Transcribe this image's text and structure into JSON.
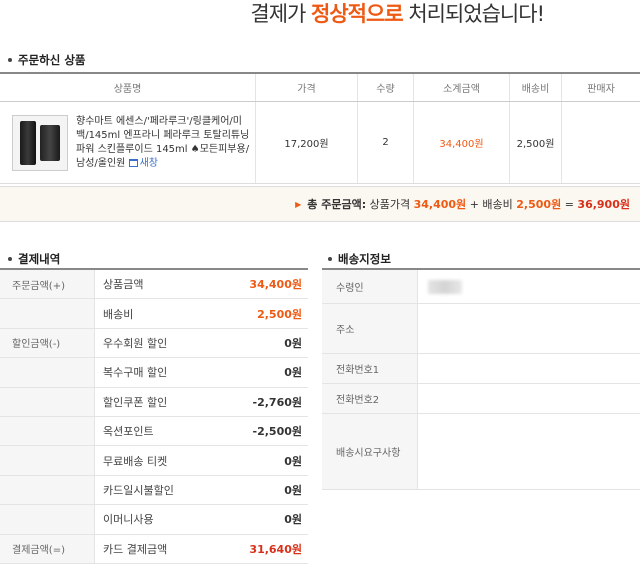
{
  "banner": {
    "before": "결제가 ",
    "highlight": "정상적으로",
    "after": " 처리되었습니다!"
  },
  "order_section": {
    "title": "주문하신 상품"
  },
  "order_table": {
    "headers": [
      "상품명",
      "가격",
      "수량",
      "소계금액",
      "배송비",
      "판매자"
    ],
    "row": {
      "product_name": "향수마트 에센스/'페라루크'/링클케어/미백/145ml 엔프라니 페라루크 토탈리튜닝 파워 스킨플루이드 145ml ♠모든피부용/남성/올인원",
      "new_window": "새창",
      "price": "17,200원",
      "qty": "2",
      "subtotal": "34,400원",
      "shipping": "2,500원",
      "seller": ""
    }
  },
  "total_bar": {
    "label": "총 주문금액:",
    "goods_label": "상품가격",
    "goods_value": "34,400원",
    "plus": "+",
    "ship_label": "배송비",
    "ship_value": "2,500원",
    "eq": "=",
    "total": "36,900원"
  },
  "payment_section": {
    "title": "결제내역"
  },
  "payment": {
    "order_cat": "주문금액(+)",
    "goods_label": "상품금액",
    "goods_value": "34,400원",
    "ship_label": "배송비",
    "ship_value": "2,500원",
    "discount_cat": "할인금액(-)",
    "vip_label": "우수회원 할인",
    "vip_value": "0원",
    "multi_label": "복수구매 할인",
    "multi_value": "0원",
    "coupon_label": "할인쿠폰 할인",
    "coupon_value": "-2,760원",
    "point_label": "옥션포인트",
    "point_value": "-2,500원",
    "freeship_label": "무료배송 티켓",
    "freeship_value": "0원",
    "card_label": "카드일시불할인",
    "card_value": "0원",
    "emoney_label": "이머니사용",
    "emoney_value": "0원",
    "final_cat": "결제금액(=)",
    "final_label": "카드 결제금액",
    "final_value": "31,640원"
  },
  "shipping_section": {
    "title": "배송지정보"
  },
  "shipping": {
    "recipient_label": "수령인",
    "address_label": "주소",
    "phone1_label": "전화번호1",
    "phone2_label": "전화번호2",
    "request_label": "배송시요구사항"
  }
}
